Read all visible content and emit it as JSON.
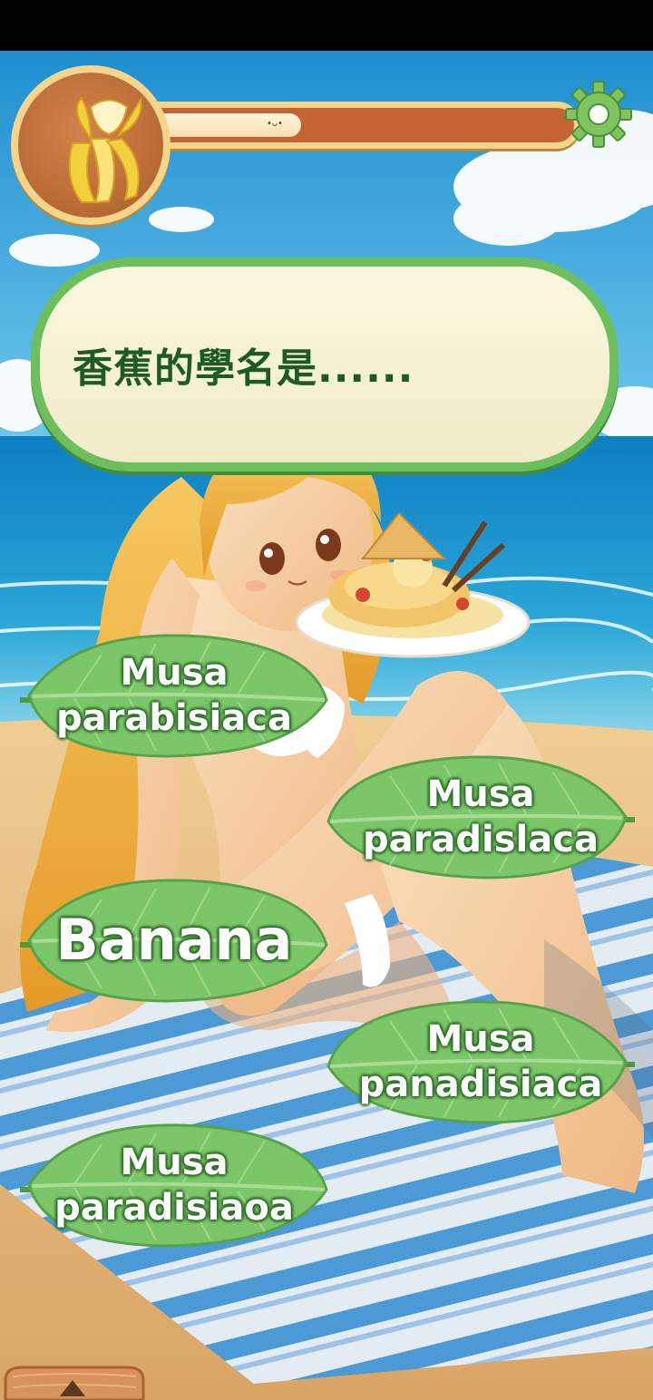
{
  "progress": {
    "value": 0.38,
    "face": "•ᴗ•"
  },
  "settings": {
    "icon": "gear-icon"
  },
  "question": {
    "text": "香蕉的學名是......"
  },
  "answers": [
    {
      "id": "a1",
      "line1": "Musa",
      "line2": "parabisiaca"
    },
    {
      "id": "a2",
      "line1": "Musa",
      "line2": "paradislaca"
    },
    {
      "id": "a3",
      "line1": "Banana",
      "line2": ""
    },
    {
      "id": "a4",
      "line1": "Musa",
      "line2": "panadisiaca"
    },
    {
      "id": "a5",
      "line1": "Musa",
      "line2": "paradisiaoa"
    }
  ],
  "colors": {
    "sky": "#2a9ed8",
    "sea": "#1a8fcf",
    "sand": "#e4b77a",
    "leaf": "#7cc66a",
    "question_text": "#1e5a28",
    "progress_track": "#c46434",
    "progress_border": "#f6d58a"
  }
}
